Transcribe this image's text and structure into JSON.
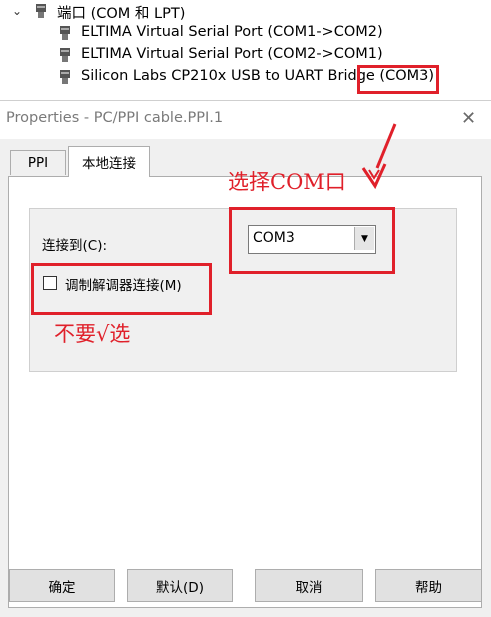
{
  "tree": {
    "category": "端口 (COM 和 LPT)",
    "items": [
      "ELTIMA Virtual Serial Port (COM1->COM2)",
      "ELTIMA Virtual Serial Port (COM2->COM1)",
      "Silicon Labs CP210x USB to UART Bridge (COM3)"
    ]
  },
  "dialog": {
    "title": "Properties - PC/PPI cable.PPI.1",
    "tabs": [
      "PPI",
      "本地连接"
    ],
    "connection_label": "连接到(C):",
    "connection_value": "COM3",
    "modem_label": "调制解调器连接(M)",
    "buttons": {
      "ok": "确定",
      "default": "默认(D)",
      "cancel": "取消",
      "help": "帮助"
    }
  },
  "annotations": {
    "select_com": "选择COM口",
    "no_check": "不要√选",
    "color": "#e0202a"
  }
}
